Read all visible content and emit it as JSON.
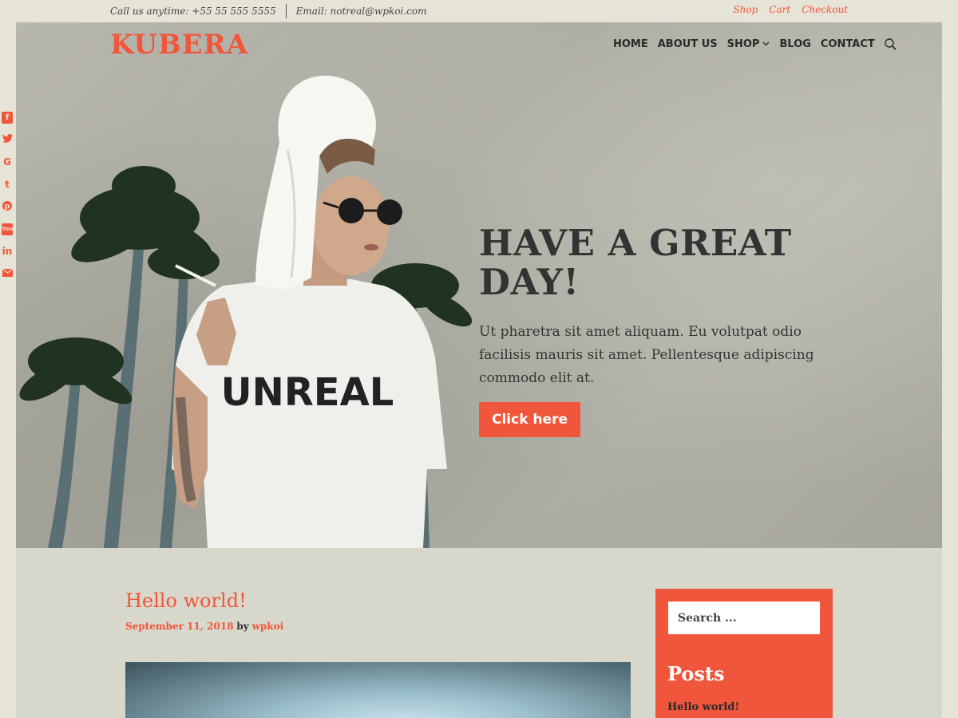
{
  "topbar": {
    "phone": "Call us anytime: +55 55 555 5555",
    "email": "Email: notreal@wpkoi.com",
    "links": [
      "Shop",
      "Cart",
      "Checkout"
    ]
  },
  "brand": {
    "logo": "KUBERA",
    "accent": "#f0563b"
  },
  "nav": {
    "items": [
      "HOME",
      "ABOUT US",
      "SHOP",
      "BLOG",
      "CONTACT"
    ],
    "shop_dropdown_icon": "chevron-down-icon",
    "search_icon": "search-icon"
  },
  "hero": {
    "title": "HAVE A GREAT DAY!",
    "text": "Ut pharetra sit amet aliquam. Eu volutpat odio facilisis mauris sit amet. Pellentesque adipiscing commodo elit at.",
    "button": "Click here",
    "shirt_text": "UNREAL"
  },
  "social": {
    "icons": [
      "facebook-icon",
      "twitter-icon",
      "google-icon",
      "tumblr-icon",
      "pinterest-icon",
      "youtube-icon",
      "linkedin-icon",
      "email-icon"
    ]
  },
  "post": {
    "title": "Hello world!",
    "date": "September 11, 2018",
    "by": "by",
    "author": "wpkoi"
  },
  "sidebar": {
    "search_placeholder": "Search ...",
    "heading": "Posts",
    "recent": [
      "Hello world!"
    ]
  }
}
